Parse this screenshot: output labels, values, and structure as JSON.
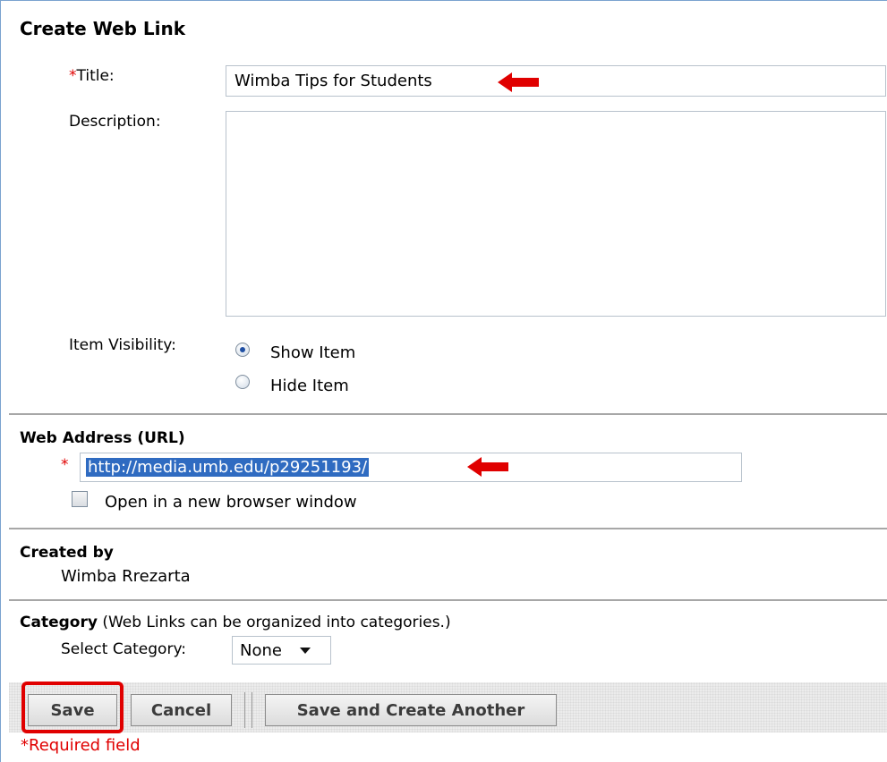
{
  "page": {
    "title": "Create Web Link",
    "required_star": "*",
    "colors": {
      "accent_red": "#e00000",
      "highlight": "#2f6bc1",
      "frame": "#7aa3cf"
    }
  },
  "form": {
    "title_label": "Title:",
    "title_value": "Wimba Tips for Students",
    "description_label": "Description:",
    "description_value": "",
    "visibility_label": "Item Visibility:",
    "visibility_options": [
      {
        "label": "Show Item",
        "checked": true
      },
      {
        "label": "Hide Item",
        "checked": false
      }
    ]
  },
  "web_address": {
    "heading": "Web Address (URL)",
    "url_value": "http://media.umb.edu/p29251193/",
    "new_window_label": "Open in a new browser window",
    "new_window_checked": false
  },
  "created_by": {
    "heading": "Created by",
    "name": "Wimba Rrezarta"
  },
  "category": {
    "heading": "Category",
    "note": " (Web Links can be organized into categories.)",
    "select_label": "Select Category:",
    "selected": "None"
  },
  "buttons": {
    "save": "Save",
    "cancel": "Cancel",
    "save_and_create": "Save and Create Another"
  },
  "footer": {
    "required_note": "*Required field"
  },
  "icons": [
    "arrow-left-icon",
    "radio-button",
    "checkbox",
    "dropdown-arrow-icon"
  ]
}
